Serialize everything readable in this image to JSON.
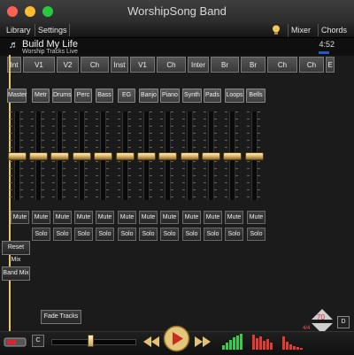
{
  "window": {
    "title": "WorshipSong Band"
  },
  "menu": {
    "library": "Library",
    "settings": "Settings",
    "mixer": "Mixer",
    "chords": "Chords"
  },
  "song": {
    "title": "Build My Life",
    "artist": "Worship Tracks Live",
    "duration": "4:52"
  },
  "sections": [
    "Int",
    "V1",
    "V2",
    "Ch",
    "Inst",
    "V1",
    "Ch",
    "Inter",
    "Br",
    "Br",
    "Ch",
    "Ch",
    "E"
  ],
  "tracks": [
    "Master",
    "Metr",
    "Drums",
    "Perc",
    "Bass",
    "EG",
    "Banjo",
    "Piano",
    "Synth",
    "Pads",
    "Loops",
    "Bells"
  ],
  "fader_levels": [
    0.5,
    0.5,
    0.5,
    0.5,
    0.5,
    0.5,
    0.5,
    0.5,
    0.5,
    0.5,
    0.5,
    0.5
  ],
  "mute_label": "Mute",
  "solo_label": "Solo",
  "buttons": {
    "reset_mix": "Reset Mix",
    "band_mix": "Band Mix",
    "fade_tracks": "Fade Tracks"
  },
  "transport": {
    "key": "C",
    "tempo": "70",
    "time_signature": "4/4",
    "display_mode": "D",
    "position": 0.45
  },
  "colors": {
    "accent_gold": "#d9b46a",
    "tempo_red": "#e02828",
    "meter_green": "#2bd34a",
    "meter_red": "#e83a2a"
  }
}
